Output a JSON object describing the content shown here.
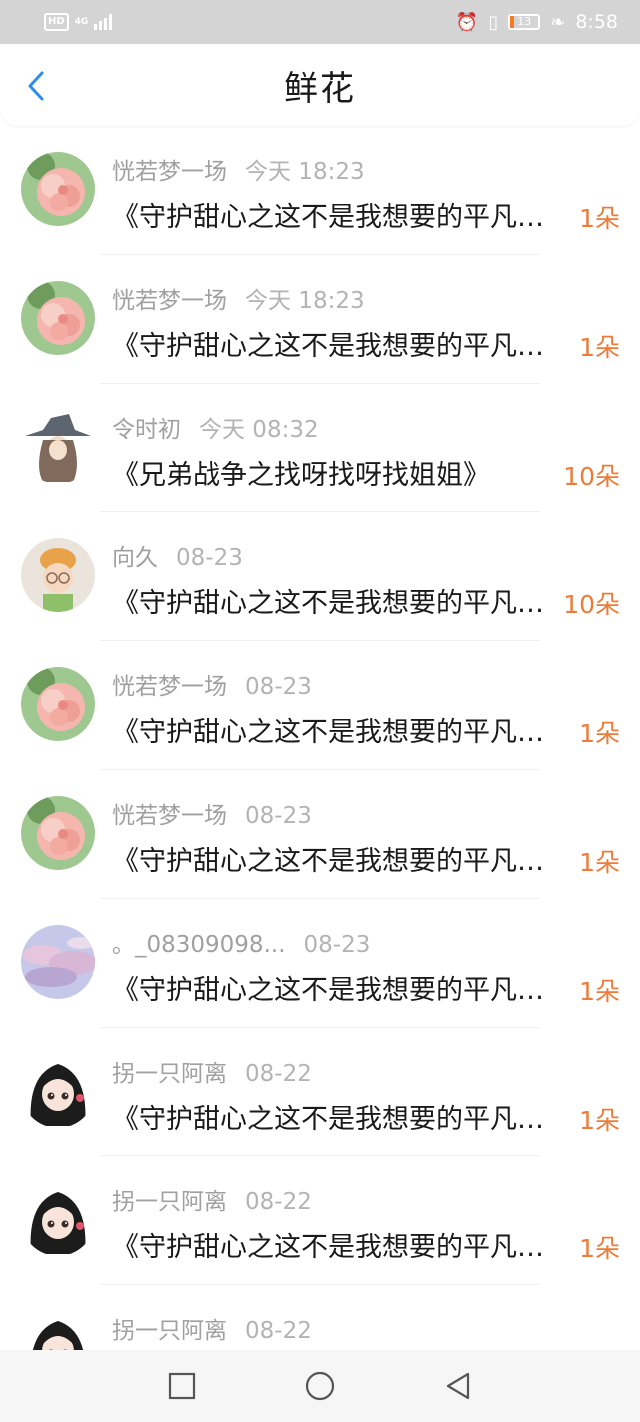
{
  "status_bar": {
    "hd": "HD",
    "net": "4G",
    "battery": "13",
    "time": "8:58"
  },
  "header": {
    "title": "鲜花"
  },
  "items": [
    {
      "name": "恍若梦一场",
      "time": "今天 18:23",
      "title": "《守护甜心之这不是我想要的平凡生活》",
      "count": "1朵",
      "avatar": "flower"
    },
    {
      "name": "恍若梦一场",
      "time": "今天 18:23",
      "title": "《守护甜心之这不是我想要的平凡生活》",
      "count": "1朵",
      "avatar": "flower"
    },
    {
      "name": "令时初",
      "time": "今天 08:32",
      "title": "《兄弟战争之找呀找呀找姐姐》",
      "count": "10朵",
      "avatar": "witch"
    },
    {
      "name": "向久",
      "time": "08-23",
      "title": "《守护甜心之这不是我想要的平凡生活》",
      "count": "10朵",
      "avatar": "child"
    },
    {
      "name": "恍若梦一场",
      "time": "08-23",
      "title": "《守护甜心之这不是我想要的平凡生活》",
      "count": "1朵",
      "avatar": "flower"
    },
    {
      "name": "恍若梦一场",
      "time": "08-23",
      "title": "《守护甜心之这不是我想要的平凡生活》",
      "count": "1朵",
      "avatar": "flower"
    },
    {
      "name": "。_08309098...",
      "time": "08-23",
      "title": "《守护甜心之这不是我想要的平凡生活》",
      "count": "1朵",
      "avatar": "sky"
    },
    {
      "name": "拐一只阿离",
      "time": "08-22",
      "title": "《守护甜心之这不是我想要的平凡生活》",
      "count": "1朵",
      "avatar": "girl"
    },
    {
      "name": "拐一只阿离",
      "time": "08-22",
      "title": "《守护甜心之这不是我想要的平凡生活》",
      "count": "1朵",
      "avatar": "girl"
    },
    {
      "name": "拐一只阿离",
      "time": "08-22",
      "title": "",
      "count": "",
      "avatar": "girl"
    }
  ],
  "nav_bar": {
    "icons": [
      "recent-apps-icon",
      "home-icon",
      "back-icon"
    ]
  },
  "colors": {
    "accent_blue": "#2d8cf0",
    "count_orange": "#ec7c39",
    "status_bar_bg": "#d4d4d4"
  }
}
